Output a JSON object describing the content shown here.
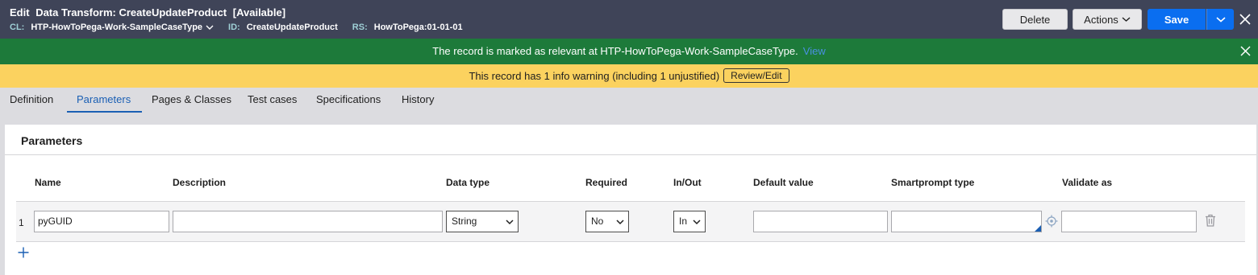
{
  "header": {
    "edit_label": "Edit",
    "title": "Data Transform: CreateUpdateProduct",
    "status": "[Available]",
    "cl_key": "CL:",
    "cl_value": "HTP-HowToPega-Work-SampleCaseType",
    "id_key": "ID:",
    "id_value": "CreateUpdateProduct",
    "rs_key": "RS:",
    "rs_value": "HowToPega:01-01-01",
    "delete_label": "Delete",
    "actions_label": "Actions",
    "save_label": "Save",
    "icons": {
      "close": "close-icon",
      "chevron": "chevron-down-icon"
    },
    "colors": {
      "bg": "#3f4458",
      "save": "#0a6ef0"
    }
  },
  "banner_relevant": {
    "message": "The record is marked as relevant at HTP-HowToPega-Work-SampleCaseType.",
    "link": "View",
    "color": "#1d7a3a"
  },
  "banner_warning": {
    "message": "This record has 1 info warning (including 1 unjustified)",
    "button": "Review/Edit",
    "color": "#fbd25f"
  },
  "tabs": [
    {
      "label": "Definition",
      "active": false
    },
    {
      "label": "Parameters",
      "active": true
    },
    {
      "label": "Pages & Classes",
      "active": false
    },
    {
      "label": "Test cases",
      "active": false
    },
    {
      "label": "Specifications",
      "active": false
    },
    {
      "label": "History",
      "active": false
    }
  ],
  "panel": {
    "title": "Parameters",
    "columns": [
      "Name",
      "Description",
      "Data type",
      "Required",
      "In/Out",
      "Default value",
      "Smartprompt type",
      "Validate as"
    ],
    "rows": [
      {
        "index": "1",
        "name": "pyGUID",
        "description": "",
        "data_type": "String",
        "required": "No",
        "in_out": "In",
        "default_value": "",
        "smartprompt_type": "",
        "validate_as": ""
      }
    ],
    "icons": {
      "add": "plus-icon",
      "delete": "trash-icon",
      "target": "crosshair-icon"
    }
  }
}
